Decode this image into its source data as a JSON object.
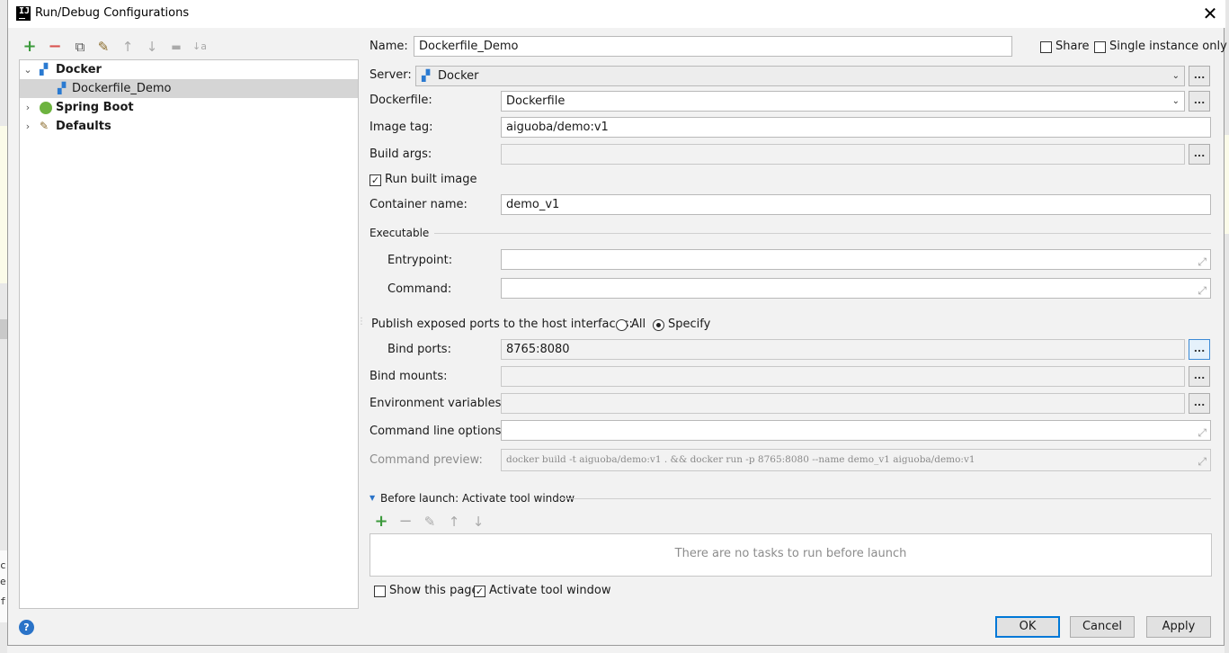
{
  "window": {
    "title": "Run/Debug Configurations",
    "app_icon_letter": "IJ"
  },
  "toolbar": {
    "add": "+",
    "remove": "−",
    "copy": "⧉",
    "edit": "✎",
    "up": "↑",
    "down": "↓",
    "folder": "▬",
    "sort": "↓a"
  },
  "tree": {
    "items": [
      {
        "label": "Docker",
        "expanded": true
      },
      {
        "label": "Dockerfile_Demo",
        "selected": true
      },
      {
        "label": "Spring Boot",
        "expanded": false
      },
      {
        "label": "Defaults",
        "expanded": false
      }
    ]
  },
  "form": {
    "name_label": "Name:",
    "name_value": "Dockerfile_Demo",
    "share_label": "Share",
    "single_instance_label": "Single instance only",
    "server_label": "Server:",
    "server_value": "Docker",
    "dockerfile_label": "Dockerfile:",
    "dockerfile_value": "Dockerfile",
    "image_tag_label": "Image tag:",
    "image_tag_value": "aiguoba/demo:v1",
    "build_args_label": "Build args:",
    "build_args_value": "",
    "run_built_image_label": "Run built image",
    "container_name_label": "Container name:",
    "container_name_value": "demo_v1",
    "executable_label": "Executable",
    "entrypoint_label": "Entrypoint:",
    "entrypoint_value": "",
    "command_label": "Command:",
    "command_value": "",
    "publish_label": "Publish exposed ports to the host interfaces:",
    "publish_all_label": "All",
    "publish_specify_label": "Specify",
    "bind_ports_label": "Bind ports:",
    "bind_ports_value": "8765:8080",
    "bind_mounts_label": "Bind mounts:",
    "bind_mounts_value": "",
    "env_vars_label": "Environment variables:",
    "env_vars_value": "",
    "cmd_options_label": "Command line options:",
    "cmd_options_value": "",
    "cmd_preview_label": "Command preview:",
    "cmd_preview_value": "docker build -t aiguoba/demo:v1 . && docker run -p 8765:8080 --name demo_v1 aiguoba/demo:v1",
    "dots": "..."
  },
  "before_launch": {
    "title": "Before launch: Activate tool window",
    "empty_text": "There are no tasks to run before launch",
    "show_page_label": "Show this page",
    "activate_label": "Activate tool window"
  },
  "buttons": {
    "ok": "OK",
    "cancel": "Cancel",
    "apply": "Apply",
    "help": "?"
  },
  "background": {
    "letters": [
      "c",
      "e",
      "f"
    ]
  },
  "colors": {
    "add_green": "#3c9a3c",
    "remove_red": "#d9534f",
    "docker_blue": "#2a7ad1",
    "spring_green": "#6db33f",
    "help_blue": "#2a73c8",
    "primary_border": "#0078d7"
  }
}
